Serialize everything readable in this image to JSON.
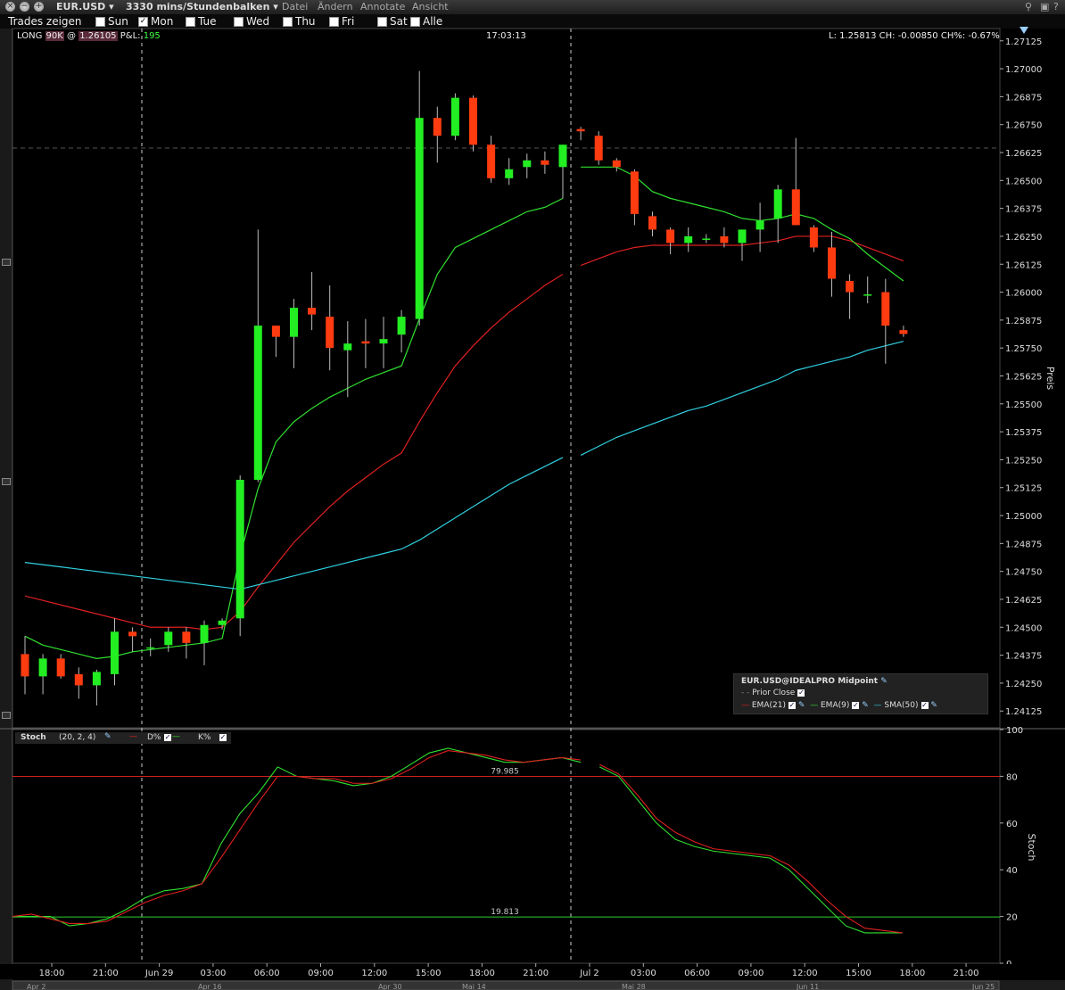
{
  "window": {
    "symbol": "EUR.USD",
    "timeframe": "3330 mins/Stundenbalken",
    "menus": [
      "Datei",
      "Ändern",
      "Annotate",
      "Ansicht"
    ]
  },
  "trades_bar": {
    "label": "Trades zeigen",
    "days": [
      {
        "label": "Sun",
        "checked": false
      },
      {
        "label": "Mon",
        "checked": true
      },
      {
        "label": "Tue",
        "checked": false
      },
      {
        "label": "Wed",
        "checked": false
      },
      {
        "label": "Thu",
        "checked": false
      },
      {
        "label": "Fri",
        "checked": false
      },
      {
        "label": "Sat",
        "checked": false
      },
      {
        "label": "Alle",
        "checked": false
      }
    ]
  },
  "info": {
    "position_prefix": "LONG",
    "position_size": "90K",
    "at": "@",
    "entry": "1.26105",
    "pnl_label": "P&L:",
    "pnl_value": "195",
    "time": "17:03:13",
    "last_stats": "L: 1.25813 CH: -0.00850 CH%: -0.67%"
  },
  "price_panel": {
    "axis_title": "Preis",
    "ticks": [
      "1.27125",
      "1.27000",
      "1.26875",
      "1.26750",
      "1.26625",
      "1.26500",
      "1.26375",
      "1.26250",
      "1.26125",
      "1.26000",
      "1.25875",
      "1.25750",
      "1.25625",
      "1.25500",
      "1.25375",
      "1.25250",
      "1.25125",
      "1.25000",
      "1.24875",
      "1.24750",
      "1.24625",
      "1.24500",
      "1.24375",
      "1.24250",
      "1.24125"
    ],
    "ylim": [
      1.2405,
      1.2718
    ],
    "prior_close": 1.26645
  },
  "legend": {
    "title": "EUR.USD@IDEALPRO Midpoint",
    "prior_close_label": "Prior Close",
    "items": [
      {
        "name": "EMA(21)",
        "color": "#e82020"
      },
      {
        "name": "EMA(9)",
        "color": "#30e030"
      },
      {
        "name": "SMA(50)",
        "color": "#30d0e0"
      }
    ]
  },
  "stoch_panel": {
    "name": "Stoch",
    "params": "(20, 2, 4)",
    "d_label": "D%",
    "k_label": "K%",
    "axis_title": "Stoch",
    "ticks": [
      "100",
      "80",
      "60",
      "40",
      "20",
      "0"
    ],
    "upper_line_label": "79.985",
    "lower_line_label": "19.813",
    "upper_value": 79.985,
    "lower_value": 19.813
  },
  "time_axis": {
    "labels": [
      "18:00",
      "21:00",
      "Jun 29",
      "03:00",
      "06:00",
      "09:00",
      "12:00",
      "15:00",
      "18:00",
      "21:00",
      "Jul 2",
      "03:00",
      "06:00",
      "09:00",
      "12:00",
      "15:00",
      "18:00",
      "21:00"
    ],
    "navigator": [
      "Apr 2",
      "Apr 16",
      "Apr 30",
      "Mai 14",
      "Mai 28",
      "Jun 11",
      "Jun 25"
    ]
  },
  "chart_data": {
    "type": "candlestick",
    "session_break_after_index": 30,
    "candles": [
      {
        "o": 1.2438,
        "h": 1.2446,
        "l": 1.242,
        "c": 1.2428
      },
      {
        "o": 1.2428,
        "h": 1.2438,
        "l": 1.242,
        "c": 1.2436
      },
      {
        "o": 1.2436,
        "h": 1.2438,
        "l": 1.2427,
        "c": 1.2428
      },
      {
        "o": 1.2429,
        "h": 1.2432,
        "l": 1.2418,
        "c": 1.2424
      },
      {
        "o": 1.2424,
        "h": 1.2431,
        "l": 1.2415,
        "c": 1.243
      },
      {
        "o": 1.2429,
        "h": 1.2454,
        "l": 1.2424,
        "c": 1.2448
      },
      {
        "o": 1.2448,
        "h": 1.245,
        "l": 1.2439,
        "c": 1.2446
      },
      {
        "o": 1.2441,
        "h": 1.2445,
        "l": 1.2437,
        "c": 1.2441
      },
      {
        "o": 1.2442,
        "h": 1.245,
        "l": 1.2439,
        "c": 1.2448
      },
      {
        "o": 1.2448,
        "h": 1.245,
        "l": 1.2436,
        "c": 1.2443
      },
      {
        "o": 1.2443,
        "h": 1.2453,
        "l": 1.2433,
        "c": 1.2451
      },
      {
        "o": 1.2451,
        "h": 1.2454,
        "l": 1.2449,
        "c": 1.2453
      },
      {
        "o": 1.2454,
        "h": 1.2518,
        "l": 1.2446,
        "c": 1.2516
      },
      {
        "o": 1.2516,
        "h": 1.2628,
        "l": 1.2515,
        "c": 1.2585
      },
      {
        "o": 1.2585,
        "h": 1.2585,
        "l": 1.2571,
        "c": 1.258
      },
      {
        "o": 1.258,
        "h": 1.2597,
        "l": 1.2566,
        "c": 1.2593
      },
      {
        "o": 1.2593,
        "h": 1.2609,
        "l": 1.2583,
        "c": 1.259
      },
      {
        "o": 1.2589,
        "h": 1.2603,
        "l": 1.2565,
        "c": 1.2575
      },
      {
        "o": 1.2574,
        "h": 1.2587,
        "l": 1.2553,
        "c": 1.2577
      },
      {
        "o": 1.2578,
        "h": 1.2588,
        "l": 1.2566,
        "c": 1.2577
      },
      {
        "o": 1.2577,
        "h": 1.2589,
        "l": 1.2566,
        "c": 1.2579
      },
      {
        "o": 1.2581,
        "h": 1.2592,
        "l": 1.2573,
        "c": 1.2589
      },
      {
        "o": 1.2588,
        "h": 1.2699,
        "l": 1.2585,
        "c": 1.2678
      },
      {
        "o": 1.2678,
        "h": 1.2683,
        "l": 1.2658,
        "c": 1.267
      },
      {
        "o": 1.267,
        "h": 1.2689,
        "l": 1.2668,
        "c": 1.2687
      },
      {
        "o": 1.2687,
        "h": 1.2688,
        "l": 1.2663,
        "c": 1.2666
      },
      {
        "o": 1.2666,
        "h": 1.267,
        "l": 1.2649,
        "c": 1.2651
      },
      {
        "o": 1.2651,
        "h": 1.266,
        "l": 1.2648,
        "c": 1.2655
      },
      {
        "o": 1.2656,
        "h": 1.2662,
        "l": 1.2651,
        "c": 1.2659
      },
      {
        "o": 1.2659,
        "h": 1.2663,
        "l": 1.2653,
        "c": 1.2657
      },
      {
        "o": 1.2656,
        "h": 1.2666,
        "l": 1.2642,
        "c": 1.2666
      },
      {
        "o": 1.2673,
        "h": 1.2674,
        "l": 1.2668,
        "c": 1.2672
      },
      {
        "o": 1.267,
        "h": 1.2672,
        "l": 1.2657,
        "c": 1.2659
      },
      {
        "o": 1.2659,
        "h": 1.266,
        "l": 1.2654,
        "c": 1.2656
      },
      {
        "o": 1.2654,
        "h": 1.2655,
        "l": 1.263,
        "c": 1.2635
      },
      {
        "o": 1.2634,
        "h": 1.2636,
        "l": 1.2625,
        "c": 1.2628
      },
      {
        "o": 1.2628,
        "h": 1.2629,
        "l": 1.2617,
        "c": 1.2622
      },
      {
        "o": 1.2622,
        "h": 1.2629,
        "l": 1.2618,
        "c": 1.2625
      },
      {
        "o": 1.2624,
        "h": 1.2626,
        "l": 1.2622,
        "c": 1.2624
      },
      {
        "o": 1.2625,
        "h": 1.2629,
        "l": 1.262,
        "c": 1.2622
      },
      {
        "o": 1.2622,
        "h": 1.2628,
        "l": 1.2614,
        "c": 1.2628
      },
      {
        "o": 1.2628,
        "h": 1.264,
        "l": 1.2618,
        "c": 1.2632
      },
      {
        "o": 1.2633,
        "h": 1.2648,
        "l": 1.2622,
        "c": 1.2646
      },
      {
        "o": 1.2646,
        "h": 1.2669,
        "l": 1.263,
        "c": 1.263
      },
      {
        "o": 1.2629,
        "h": 1.263,
        "l": 1.2618,
        "c": 1.262
      },
      {
        "o": 1.262,
        "h": 1.2627,
        "l": 1.2598,
        "c": 1.2606
      },
      {
        "o": 1.2605,
        "h": 1.2608,
        "l": 1.2588,
        "c": 1.26
      },
      {
        "o": 1.2599,
        "h": 1.2607,
        "l": 1.2595,
        "c": 1.2599
      },
      {
        "o": 1.26,
        "h": 1.2606,
        "l": 1.2568,
        "c": 1.2585
      },
      {
        "o": 1.2583,
        "h": 1.2585,
        "l": 1.258,
        "c": 1.25813
      }
    ],
    "series": [
      {
        "name": "EMA(21)",
        "color": "#e02020",
        "values": [
          1.2464,
          1.2462,
          1.246,
          1.2458,
          1.2456,
          1.2454,
          1.2452,
          1.245,
          1.245,
          1.245,
          1.2449,
          1.245,
          1.2457,
          1.2468,
          1.2478,
          1.2488,
          1.2496,
          1.2504,
          1.2511,
          1.2517,
          1.2523,
          1.2528,
          1.2542,
          1.2555,
          1.2567,
          1.2576,
          1.2584,
          1.2591,
          1.2597,
          1.2603,
          1.2608,
          1.2612,
          1.2615,
          1.2618,
          1.262,
          1.2621,
          1.2621,
          1.2621,
          1.2621,
          1.2621,
          1.2621,
          1.2622,
          1.2623,
          1.2625,
          1.2625,
          1.2625,
          1.2623,
          1.262,
          1.2617,
          1.2614
        ]
      },
      {
        "name": "EMA(9)",
        "color": "#30e030",
        "values": [
          1.2446,
          1.2442,
          1.244,
          1.2438,
          1.2436,
          1.2437,
          1.2439,
          1.244,
          1.2441,
          1.2442,
          1.2443,
          1.2445,
          1.2482,
          1.2512,
          1.2533,
          1.2542,
          1.2548,
          1.2553,
          1.2557,
          1.2561,
          1.2564,
          1.2567,
          1.2588,
          1.2608,
          1.262,
          1.2624,
          1.2628,
          1.2632,
          1.2636,
          1.2638,
          1.2642,
          1.2656,
          1.2656,
          1.2656,
          1.2652,
          1.2645,
          1.2642,
          1.264,
          1.2638,
          1.2636,
          1.2633,
          1.2632,
          1.2633,
          1.2635,
          1.2633,
          1.2628,
          1.2624,
          1.2617,
          1.2611,
          1.2605
        ]
      },
      {
        "name": "SMA(50)",
        "color": "#30d0e0",
        "values": [
          1.2479,
          1.2478,
          1.2477,
          1.2476,
          1.2475,
          1.2474,
          1.2473,
          1.2472,
          1.2471,
          1.247,
          1.2469,
          1.2468,
          1.2467,
          1.2469,
          1.2471,
          1.2473,
          1.2475,
          1.2477,
          1.2479,
          1.2481,
          1.2483,
          1.2485,
          1.2489,
          1.2494,
          1.2499,
          1.2504,
          1.2509,
          1.2514,
          1.2518,
          1.2522,
          1.2526,
          1.2527,
          1.2531,
          1.2535,
          1.2538,
          1.2541,
          1.2544,
          1.2547,
          1.2549,
          1.2552,
          1.2555,
          1.2558,
          1.2561,
          1.2565,
          1.2567,
          1.2569,
          1.2571,
          1.2574,
          1.2576,
          1.2578
        ]
      }
    ],
    "stoch": {
      "k": [
        20,
        20,
        20,
        16,
        17,
        19,
        23,
        28,
        31,
        32,
        34,
        51,
        64,
        73,
        84,
        80,
        79,
        78,
        76,
        77,
        80,
        85,
        90,
        92,
        90,
        88,
        86,
        86,
        87,
        88,
        86,
        84,
        80,
        70,
        60,
        53,
        50,
        48,
        47,
        46,
        45,
        40,
        32,
        24,
        16,
        13,
        13,
        13
      ],
      "d": [
        20,
        21,
        19,
        17,
        17,
        18,
        22,
        26,
        29,
        31,
        34,
        45,
        57,
        69,
        80,
        80,
        79,
        79,
        77,
        77,
        79,
        83,
        88,
        91,
        90,
        89,
        87,
        86,
        87,
        88,
        87,
        85,
        81,
        72,
        62,
        56,
        52,
        49,
        48,
        47,
        46,
        42,
        35,
        27,
        20,
        15,
        14,
        13
      ]
    }
  }
}
